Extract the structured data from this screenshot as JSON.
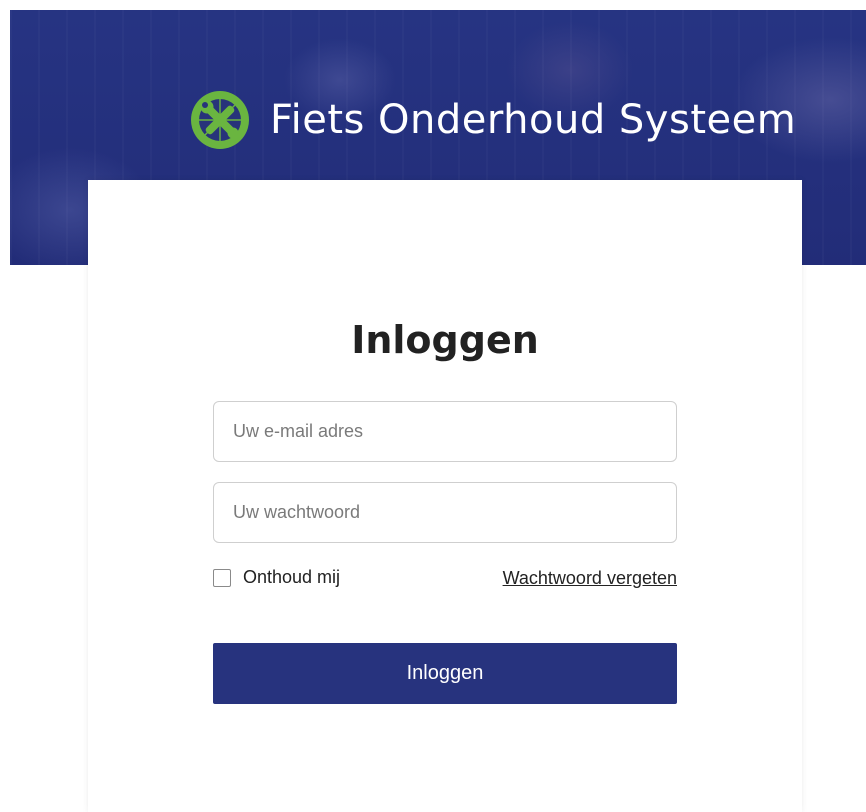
{
  "header": {
    "brand_title": "Fiets Onderhoud Systeem",
    "brand_icon": "bike-wrench-icon",
    "brand_color": "#6ab540",
    "background_color": "#27337a"
  },
  "login": {
    "title": "Inloggen",
    "email_placeholder": "Uw e-mail adres",
    "password_placeholder": "Uw wachtwoord",
    "remember_label": "Onthoud mij",
    "remember_checked": false,
    "forgot_link": "Wachtwoord vergeten",
    "submit_label": "Inloggen",
    "submit_color": "#27337e"
  }
}
